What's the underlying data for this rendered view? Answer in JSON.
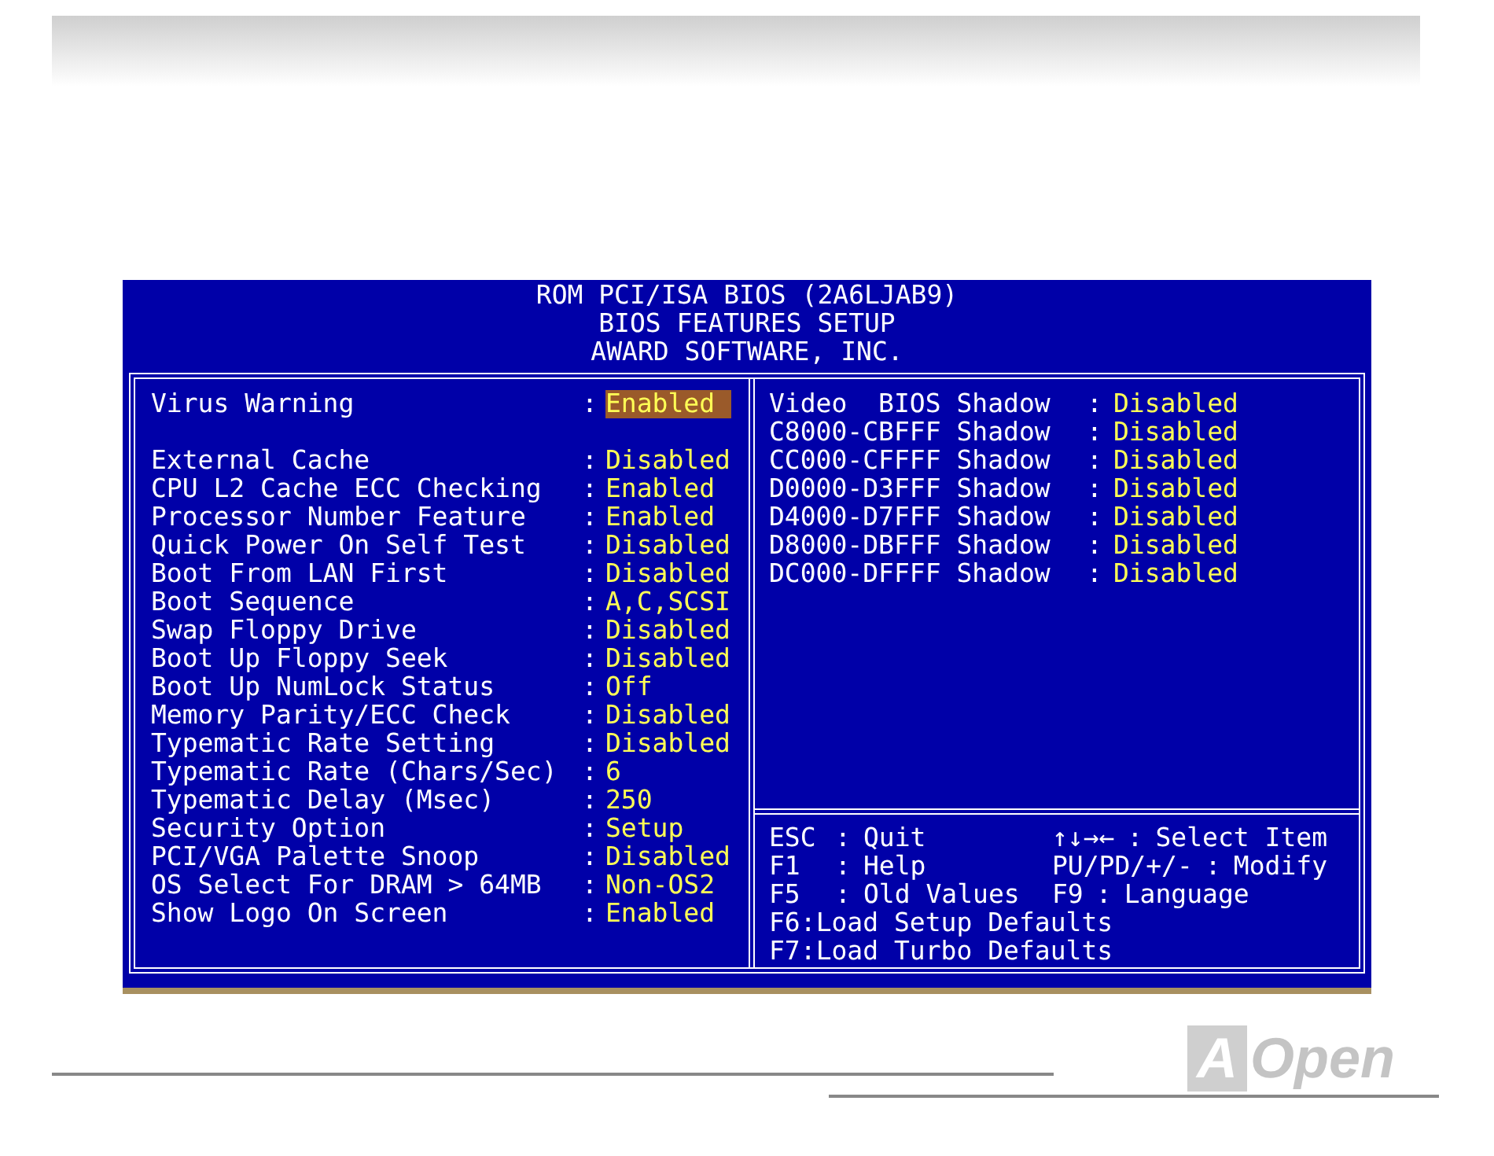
{
  "header": [
    "ROM PCI/ISA BIOS (2A6LJAB9)",
    "BIOS FEATURES SETUP",
    "AWARD SOFTWARE, INC."
  ],
  "left_groups": [
    [
      {
        "label": "Virus Warning",
        "sep": ":",
        "value": "Enabled",
        "selected": true
      }
    ],
    [
      {
        "label": "External Cache",
        "sep": ":",
        "value": "Disabled",
        "selected": false
      },
      {
        "label": "CPU L2 Cache ECC Checking",
        "sep": ":",
        "value": "Enabled",
        "selected": false
      },
      {
        "label": "Processor Number Feature",
        "sep": ":",
        "value": "Enabled",
        "selected": false
      },
      {
        "label": "Quick Power On Self Test",
        "sep": ":",
        "value": "Disabled",
        "selected": false
      },
      {
        "label": "Boot From LAN First",
        "sep": ":",
        "value": "Disabled",
        "selected": false
      },
      {
        "label": "Boot Sequence",
        "sep": ":",
        "value": "A,C,SCSI",
        "selected": false
      },
      {
        "label": "Swap Floppy Drive",
        "sep": ":",
        "value": "Disabled",
        "selected": false
      },
      {
        "label": "Boot Up Floppy Seek",
        "sep": ":",
        "value": "Disabled",
        "selected": false
      },
      {
        "label": "Boot Up NumLock Status",
        "sep": ":",
        "value": "Off",
        "selected": false
      },
      {
        "label": "Memory Parity/ECC Check",
        "sep": ":",
        "value": "Disabled",
        "selected": false
      },
      {
        "label": "Typematic Rate Setting",
        "sep": ":",
        "value": "Disabled",
        "selected": false
      },
      {
        "label": "Typematic Rate (Chars/Sec)",
        "sep": ":",
        "value": "6",
        "selected": false
      },
      {
        "label": "Typematic Delay (Msec)",
        "sep": ":",
        "value": "250",
        "selected": false
      },
      {
        "label": "Security Option",
        "sep": ":",
        "value": "Setup",
        "selected": false
      },
      {
        "label": "PCI/VGA Palette Snoop",
        "sep": ":",
        "value": "Disabled",
        "selected": false
      },
      {
        "label": "OS Select For DRAM > 64MB",
        "sep": ":",
        "value": "Non-OS2",
        "selected": false
      },
      {
        "label": "Show Logo On Screen",
        "sep": ":",
        "value": "Enabled",
        "selected": false
      }
    ]
  ],
  "right_items": [
    {
      "label": "Video  BIOS Shadow",
      "sep": ":",
      "value": "Disabled"
    },
    {
      "label": "C8000-CBFFF Shadow",
      "sep": ":",
      "value": "Disabled"
    },
    {
      "label": "CC000-CFFFF Shadow",
      "sep": ":",
      "value": "Disabled"
    },
    {
      "label": "D0000-D3FFF Shadow",
      "sep": ":",
      "value": "Disabled"
    },
    {
      "label": "D4000-D7FFF Shadow",
      "sep": ":",
      "value": "Disabled"
    },
    {
      "label": "D8000-DBFFF Shadow",
      "sep": ":",
      "value": "Disabled"
    },
    {
      "label": "DC000-DFFFF Shadow",
      "sep": ":",
      "value": "Disabled"
    }
  ],
  "help": [
    [
      {
        "key": "ESC",
        "sep": ":",
        "action": "Quit"
      },
      {
        "key": "↑↓→←",
        "sep": ":",
        "action": "Select Item"
      }
    ],
    [
      {
        "key": "F1",
        "sep": ":",
        "action": "Help"
      },
      {
        "key": "PU/PD/+/-",
        "sep": ":",
        "action": "Modify"
      }
    ],
    [
      {
        "key": "F5",
        "sep": ":",
        "action": "Old Values"
      },
      {
        "key": "F9",
        "sep": ":",
        "action": "Language"
      }
    ],
    [
      {
        "key": "F6",
        "sep": ":",
        "action": "Load Setup Defaults"
      }
    ],
    [
      {
        "key": "F7",
        "sep": ":",
        "action": "Load Turbo Defaults"
      }
    ]
  ],
  "logo": {
    "mark": "A",
    "text": "Open"
  }
}
